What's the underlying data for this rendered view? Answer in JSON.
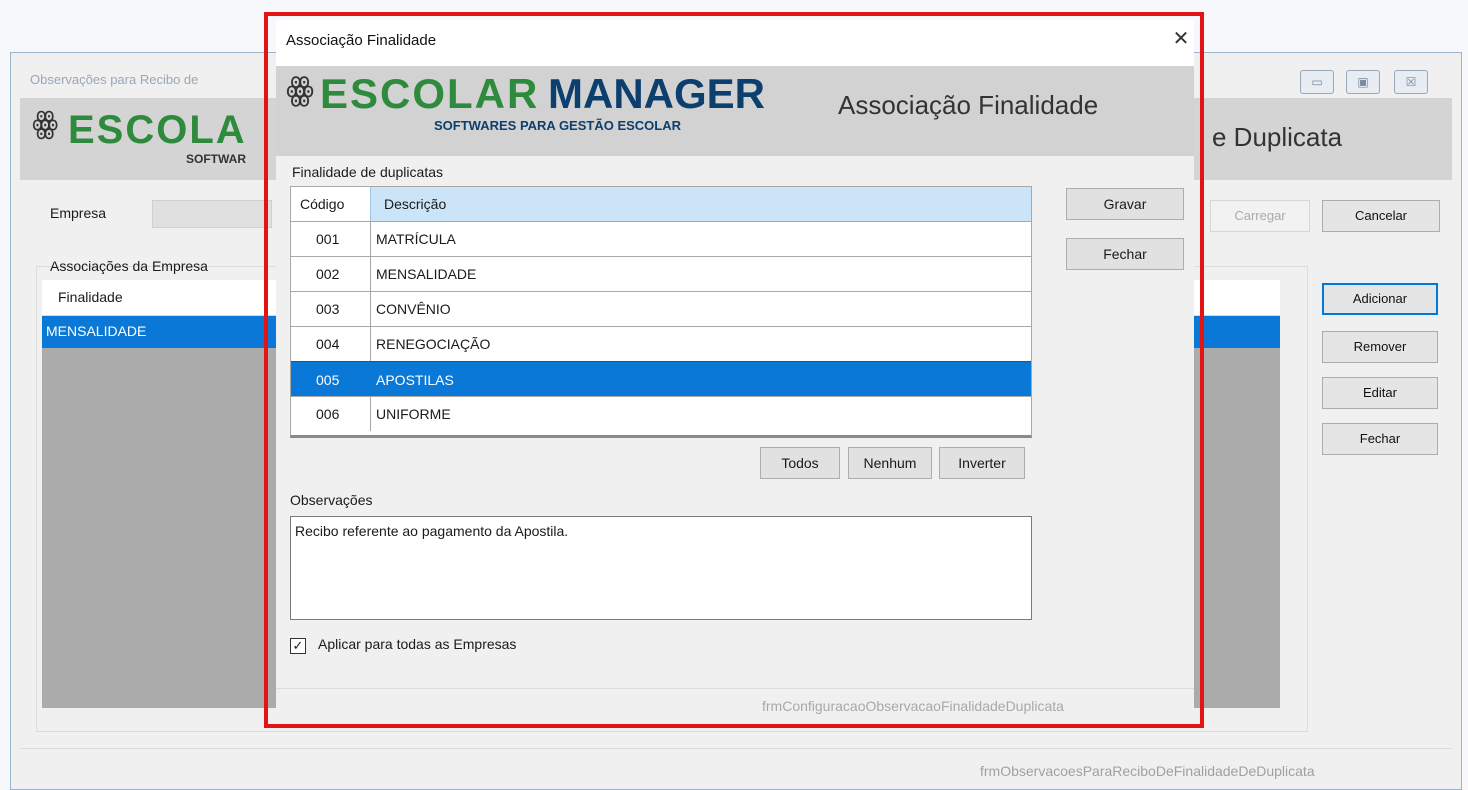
{
  "background_window": {
    "title": "Observações para Recibo de",
    "minimize": "▭",
    "maximize": "▣",
    "close": "☒",
    "logo_primary": "ESCOLA",
    "logo_secondary": "SOFTWAR",
    "header_title": "e Duplicata",
    "empresa_label": "Empresa",
    "carregar_label": "Carregar",
    "cancelar_label": "Cancelar",
    "group_label": "Associações da Empresa",
    "grid_header": "Finalidade",
    "grid_row": "MENSALIDADE",
    "adicionar_label": "Adicionar",
    "remover_label": "Remover",
    "editar_label": "Editar",
    "fechar_label": "Fechar",
    "status_text": "frmObservacoesParaReciboDeFinalidadeDeDuplicata"
  },
  "dialog": {
    "title": "Associação Finalidade",
    "close": "✕",
    "logo_escolar": "ESCOLAR",
    "logo_manager": "MANAGER",
    "logo_tagline": "SOFTWARES PARA GESTÃO ESCOLAR",
    "header_title": "Associação Finalidade",
    "list_label": "Finalidade de duplicatas",
    "columns": {
      "code": "Código",
      "description": "Descrição"
    },
    "rows": [
      {
        "code": "001",
        "description": "MATRÍCULA"
      },
      {
        "code": "002",
        "description": "MENSALIDADE"
      },
      {
        "code": "003",
        "description": "CONVÊNIO"
      },
      {
        "code": "004",
        "description": "RENEGOCIAÇÃO"
      },
      {
        "code": "005",
        "description": "APOSTILAS"
      },
      {
        "code": "006",
        "description": "UNIFORME"
      }
    ],
    "selected_row": "005",
    "gravar_label": "Gravar",
    "fechar_label": "Fechar",
    "todos_label": "Todos",
    "nenhum_label": "Nenhum",
    "inverter_label": "Inverter",
    "obs_label": "Observações",
    "obs_value": "Recibo referente ao pagamento da Apostila.",
    "apply_all_label": "Aplicar para todas as Empresas",
    "apply_all_checked": true,
    "check_mark": "✓",
    "owl_glyph": "ꙮ",
    "status_text": "frmConfiguracaoObservacaoFinalidadeDuplicata"
  },
  "colors": {
    "selection": "#0a78d7",
    "highlight_outline": "#e41414",
    "logo_green": "#2e8b3e",
    "logo_navy": "#0c3e6e"
  }
}
